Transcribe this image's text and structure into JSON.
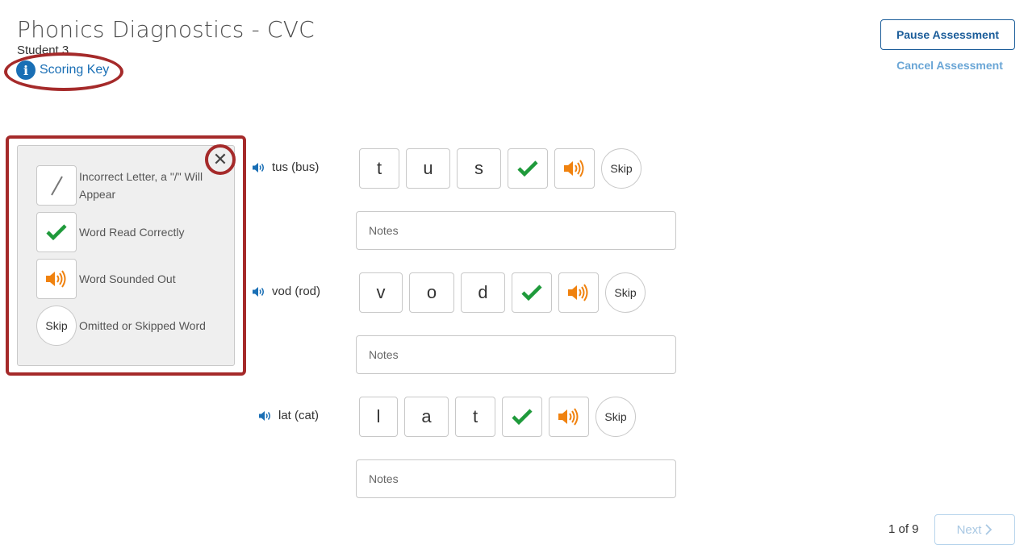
{
  "header": {
    "title": "Phonics Diagnostics - CVC",
    "student": "Student 3",
    "scoring_key_label": "Scoring Key"
  },
  "actions": {
    "pause_label": "Pause Assessment",
    "cancel_label": "Cancel Assessment"
  },
  "scoring_key": {
    "items": [
      {
        "symbol": "slash-icon",
        "text": "Incorrect Letter, a \"/\" Will Appear"
      },
      {
        "symbol": "checkmark-icon",
        "text": "Word Read Correctly"
      },
      {
        "symbol": "speaker-icon",
        "text": "Word Sounded Out"
      },
      {
        "symbol": "Skip",
        "text": "Omitted or Skipped Word"
      }
    ]
  },
  "words": [
    {
      "label": "tus (bus)",
      "letters": [
        "t",
        "u",
        "s"
      ],
      "skip_label": "Skip",
      "notes_placeholder": "Notes"
    },
    {
      "label": "vod (rod)",
      "letters": [
        "v",
        "o",
        "d"
      ],
      "skip_label": "Skip",
      "notes_placeholder": "Notes"
    },
    {
      "label": "lat (cat)",
      "letters": [
        "l",
        "a",
        "t"
      ],
      "skip_label": "Skip",
      "notes_placeholder": "Notes"
    }
  ],
  "pagination": {
    "page_text": "1 of 9",
    "next_label": "Next"
  },
  "colors": {
    "primary": "#1a5c99",
    "link": "#1a6fb5",
    "check": "#1f9a3b",
    "speaker": "#f0820f",
    "highlight": "#a52a2a"
  }
}
